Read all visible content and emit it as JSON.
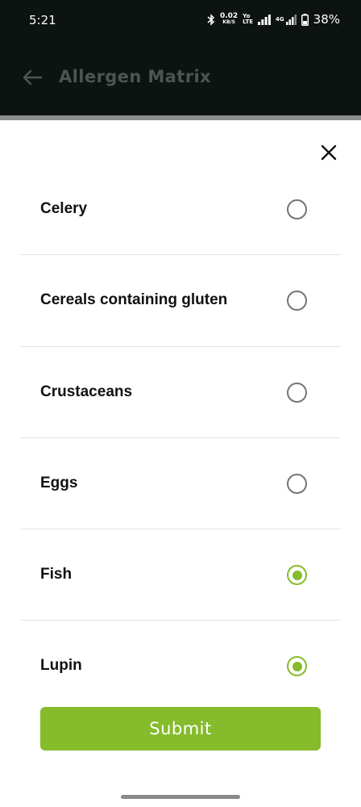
{
  "status_bar": {
    "time": "5:21",
    "net_speed_value": "0.02",
    "net_speed_unit": "KB/S",
    "volte_top": "Yo",
    "volte_bottom": "LTE",
    "network_label": "4G",
    "battery": "38%"
  },
  "app_bar": {
    "title": "Allergen Matrix"
  },
  "allergens": [
    {
      "label": "Celery",
      "checked": false
    },
    {
      "label": "Cereals containing gluten",
      "checked": false
    },
    {
      "label": "Crustaceans",
      "checked": false
    },
    {
      "label": "Eggs",
      "checked": false
    },
    {
      "label": "Fish",
      "checked": true
    },
    {
      "label": "Lupin",
      "checked": true
    }
  ],
  "submit_label": "Submit",
  "colors": {
    "accent": "#86bb2c",
    "header_bg": "#0d1311"
  }
}
